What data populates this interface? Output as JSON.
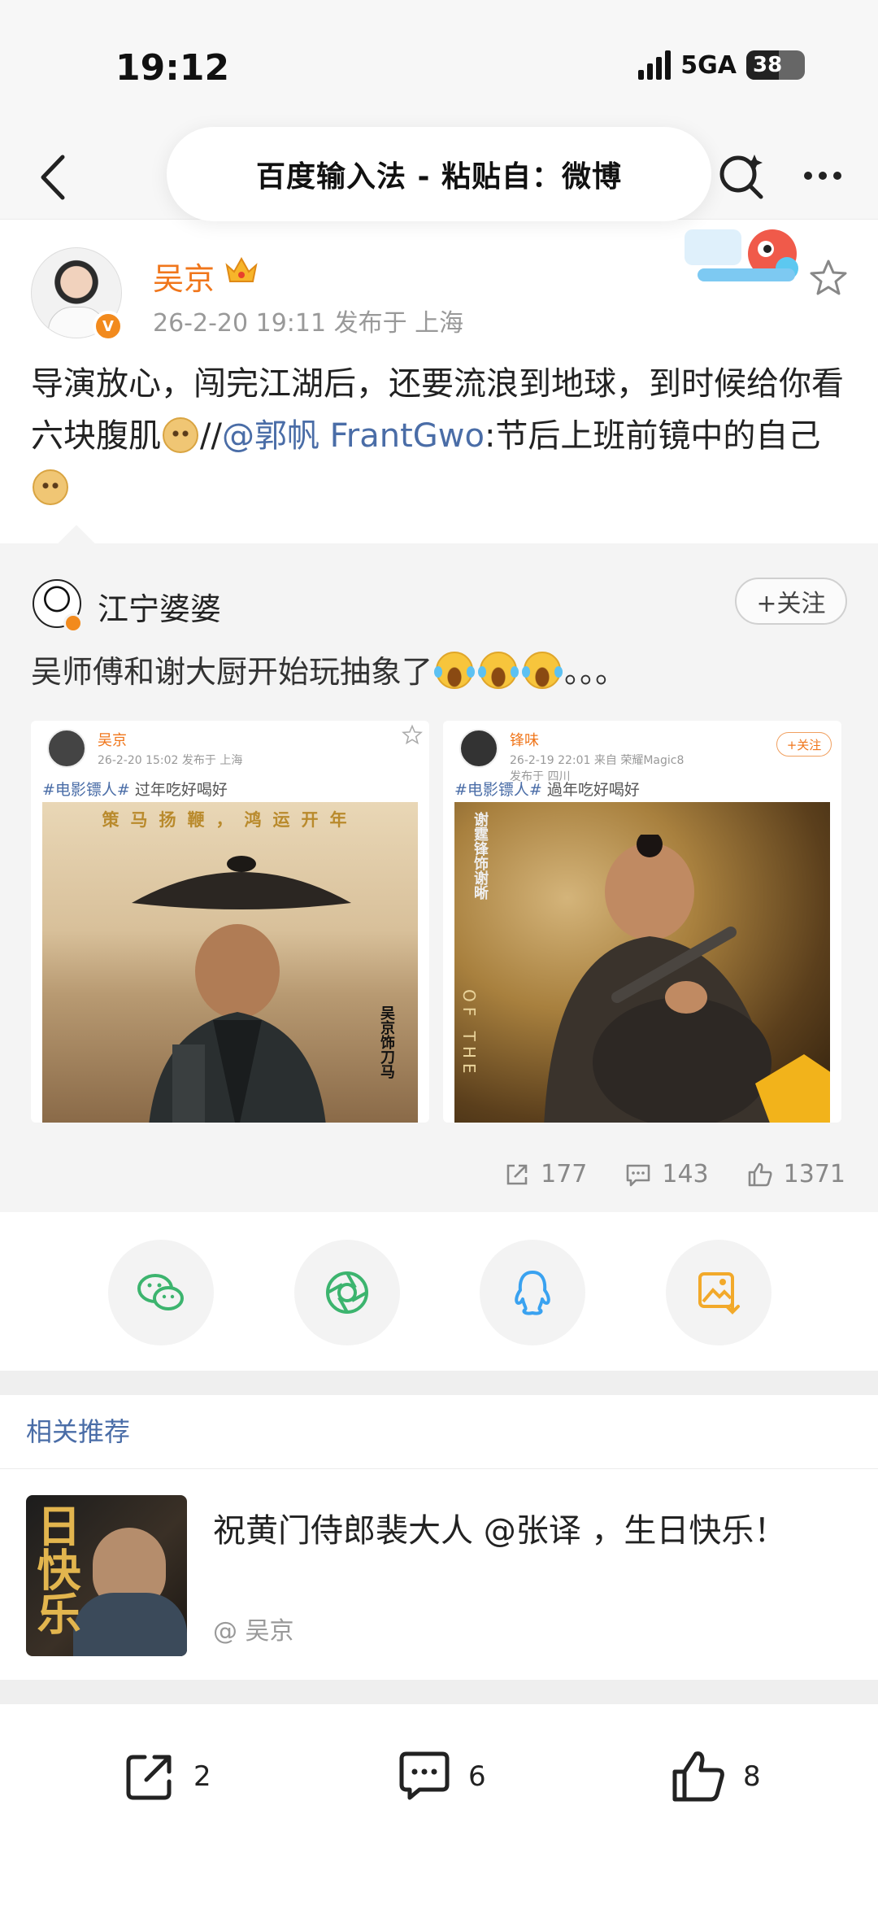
{
  "status_bar": {
    "time": "19:12",
    "network": "5GA",
    "battery": "38"
  },
  "nav": {
    "paste_notice": "百度输入法 - 粘贴自：微博"
  },
  "post": {
    "author": "吴京",
    "meta": "26-2-20 19:11  发布于 上海",
    "text_part1": "导演放心，闯完江湖后，还要流浪到地球，到时候给你看六块腹肌",
    "text_mention_prefix": "//",
    "mention": "@郭帆 FrantGwo",
    "text_part2": ":节后上班前镜中的自己"
  },
  "repost": {
    "author": "江宁婆婆",
    "follow_label": "+关注",
    "text": "吴师傅和谢大厨开始玩抽象了",
    "text_suffix": "。。。",
    "cards": [
      {
        "name": "吴京",
        "meta": "26-2-20 15:02  发布于 上海",
        "hashtag": "#电影镖人#",
        "caption": " 过年吃好喝好",
        "slogan": "策马扬鞭，鸿运开年",
        "side_text": "吴京饰刀马"
      },
      {
        "name": "锋味",
        "meta_line1": "26-2-19 22:01  来自 荣耀Magic8",
        "meta_line2": "发布于 四川",
        "follow": "+关注",
        "hashtag": "#电影镖人#",
        "caption": " 過年吃好喝好",
        "side_text": "谢霆锋饰谢晰",
        "of_text": "OF THE"
      }
    ],
    "stats": {
      "reposts": "177",
      "comments": "143",
      "likes": "1371"
    }
  },
  "share": [
    "wechat-icon",
    "moments-icon",
    "qq-icon",
    "save-image-icon"
  ],
  "related": {
    "title": "相关推荐",
    "item_text": "祝黄门侍郎裴大人 @张译 ，生日快乐！",
    "item_author": "@ 吴京",
    "thumb_text": "日快乐"
  },
  "actions": {
    "reposts": "2",
    "comments": "6",
    "likes": "8"
  },
  "colors": {
    "accent_orange": "#f0761b",
    "link_blue": "#4a6da7",
    "icon_green": "#3cb46e",
    "icon_blue": "#3aa2f0",
    "icon_yellow": "#f2a92a"
  }
}
